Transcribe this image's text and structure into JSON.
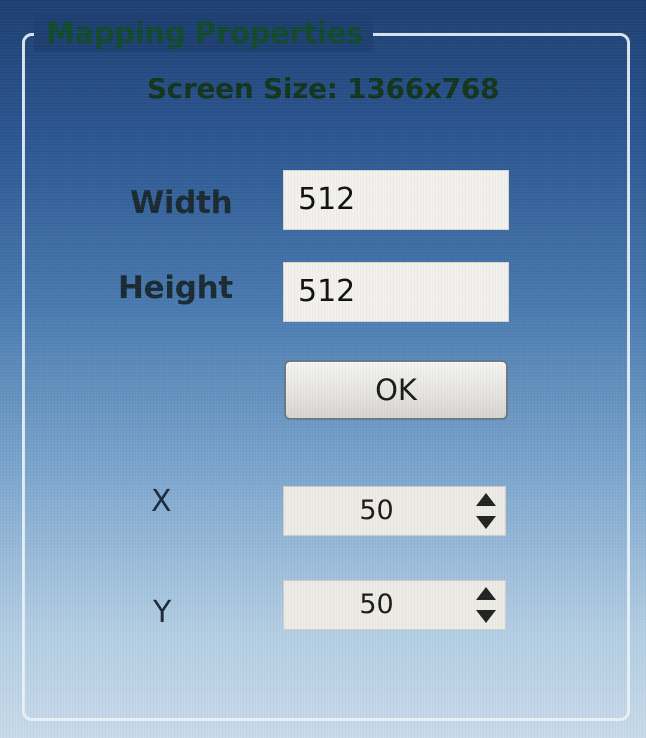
{
  "panel": {
    "title": "Mapping Properties",
    "screen_size_label": "Screen Size: 1366x768"
  },
  "dimensions": {
    "width_label": "Width",
    "width_value": "512",
    "height_label": "Height",
    "height_value": "512",
    "ok_label": "OK"
  },
  "position": {
    "x_label": "X",
    "x_value": "50",
    "y_label": "Y",
    "y_value": "50"
  },
  "icons": {
    "spin_up": "arrow-up-icon",
    "spin_down": "arrow-down-icon"
  },
  "colors": {
    "background_top": "#1d3f72",
    "background_bottom": "#c8dbea",
    "title_text": "#114a2c"
  }
}
